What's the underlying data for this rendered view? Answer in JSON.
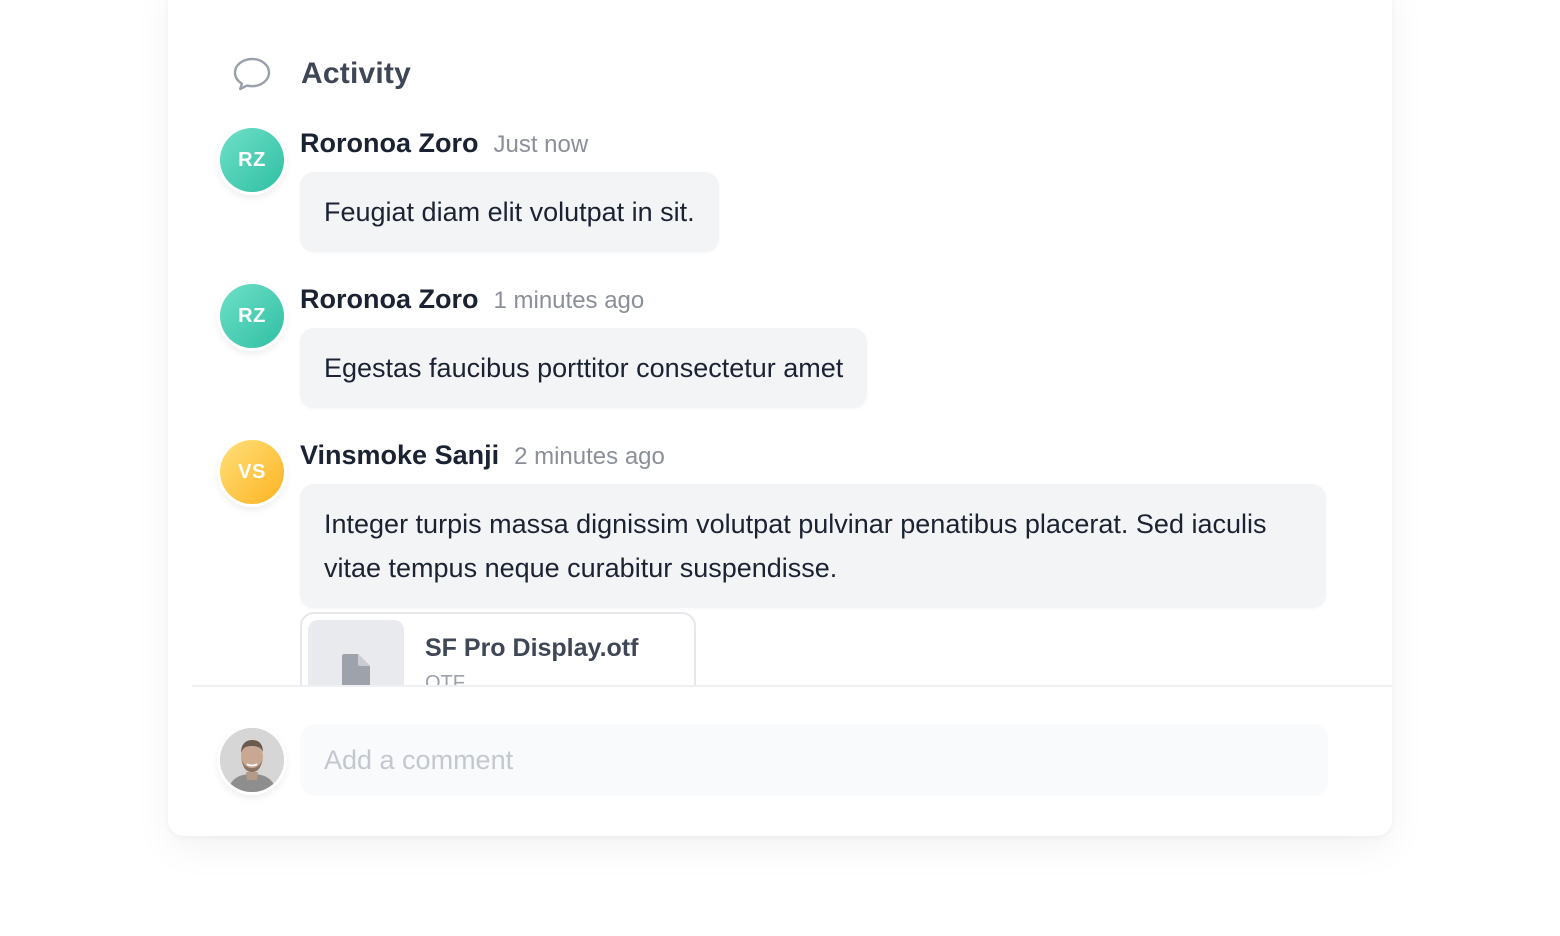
{
  "header": {
    "title": "Activity",
    "icon": "speech-bubble-icon"
  },
  "comments": [
    {
      "initials": "RZ",
      "author": "Roronoa Zoro",
      "time": "Just now",
      "text": "Feugiat diam elit volutpat in sit.",
      "avatar_color": "#3cc9ad"
    },
    {
      "initials": "RZ",
      "author": "Roronoa Zoro",
      "time": "1 minutes ago",
      "text": "Egestas faucibus porttitor consectetur amet",
      "avatar_color": "#3cc9ad"
    },
    {
      "initials": "VS",
      "author": "Vinsmoke Sanji",
      "time": "2 minutes ago",
      "text": "Integer turpis massa dignissim volutpat pulvinar penatibus placerat. Sed iaculis vitae tempus neque curabitur suspendisse.",
      "avatar_color": "#fdbb2d",
      "attachment": {
        "name": "SF Pro Display.otf",
        "type": "OTF",
        "icon": "file-icon"
      }
    }
  ],
  "composer": {
    "placeholder": "Add a comment",
    "avatar": "user-photo-avatar"
  }
}
